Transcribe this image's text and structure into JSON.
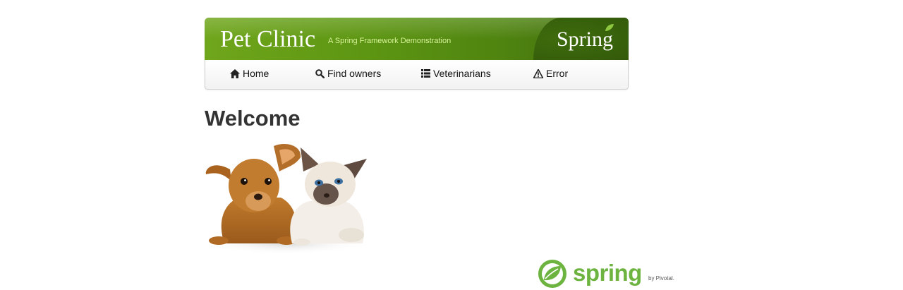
{
  "banner": {
    "title": "Pet Clinic",
    "subtitle": "A Spring Framework Demonstration",
    "brand": "Spring"
  },
  "nav": {
    "items": [
      {
        "label": "Home",
        "icon": "home-icon"
      },
      {
        "label": "Find owners",
        "icon": "search-icon"
      },
      {
        "label": "Veterinarians",
        "icon": "list-icon"
      },
      {
        "label": "Error",
        "icon": "warning-icon"
      }
    ]
  },
  "main": {
    "heading": "Welcome",
    "image": "pets-image"
  },
  "footer": {
    "logo_text": "spring",
    "logo_suffix": "by Pivotal."
  },
  "colors": {
    "banner_green": "#5c9512",
    "spring_green": "#6db33f",
    "subtitle_green": "#d8f29a"
  }
}
